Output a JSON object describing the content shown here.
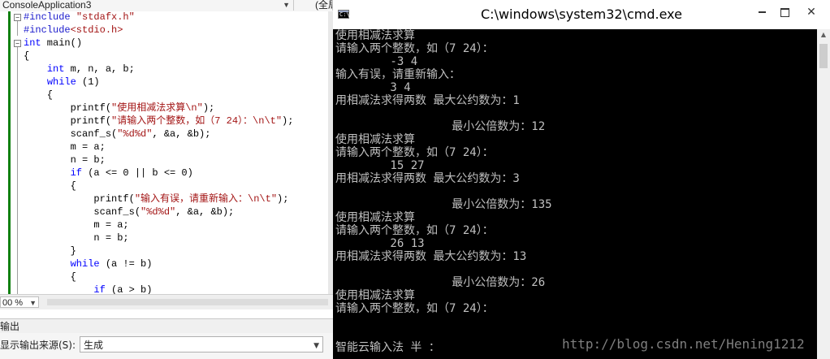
{
  "ide": {
    "nav_left": "ConsoleApplication3",
    "nav_right": "(全局范围)",
    "code": [
      [
        {
          "t": "#include ",
          "c": "pp"
        },
        {
          "t": "\"stdafx.h\"",
          "c": "str"
        }
      ],
      [
        {
          "t": "#include",
          "c": "pp"
        },
        {
          "t": "<stdio.h>",
          "c": "str"
        }
      ],
      [
        {
          "t": "int",
          "c": "kw"
        },
        {
          "t": " main()",
          "c": ""
        }
      ],
      [
        {
          "t": "{",
          "c": ""
        }
      ],
      [
        {
          "t": "    ",
          "c": ""
        },
        {
          "t": "int",
          "c": "kw"
        },
        {
          "t": " m, n, a, b;",
          "c": ""
        }
      ],
      [
        {
          "t": "    ",
          "c": ""
        },
        {
          "t": "while",
          "c": "kw"
        },
        {
          "t": " (1)",
          "c": ""
        }
      ],
      [
        {
          "t": "    {",
          "c": ""
        }
      ],
      [
        {
          "t": "        printf(",
          "c": ""
        },
        {
          "t": "\"使用相减法求算\\n\"",
          "c": "str"
        },
        {
          "t": ");",
          "c": ""
        }
      ],
      [
        {
          "t": "        printf(",
          "c": ""
        },
        {
          "t": "\"请输入两个整数，如（7 24）：\\n\\t\"",
          "c": "str"
        },
        {
          "t": ");",
          "c": ""
        }
      ],
      [
        {
          "t": "        scanf_s(",
          "c": ""
        },
        {
          "t": "\"%d%d\"",
          "c": "str"
        },
        {
          "t": ", &a, &b);",
          "c": ""
        }
      ],
      [
        {
          "t": "        m = a;",
          "c": ""
        }
      ],
      [
        {
          "t": "        n = b;",
          "c": ""
        }
      ],
      [
        {
          "t": "        ",
          "c": ""
        },
        {
          "t": "if",
          "c": "kw"
        },
        {
          "t": " (a <= 0 || b <= 0)",
          "c": ""
        }
      ],
      [
        {
          "t": "        {",
          "c": ""
        }
      ],
      [
        {
          "t": "            printf(",
          "c": ""
        },
        {
          "t": "\"输入有误，请重新输入：\\n\\t\"",
          "c": "str"
        },
        {
          "t": ");",
          "c": ""
        }
      ],
      [
        {
          "t": "            scanf_s(",
          "c": ""
        },
        {
          "t": "\"%d%d\"",
          "c": "str"
        },
        {
          "t": ", &a, &b);",
          "c": ""
        }
      ],
      [
        {
          "t": "            m = a;",
          "c": ""
        }
      ],
      [
        {
          "t": "            n = b;",
          "c": ""
        }
      ],
      [
        {
          "t": "        }",
          "c": ""
        }
      ],
      [
        {
          "t": "        ",
          "c": ""
        },
        {
          "t": "while",
          "c": "kw"
        },
        {
          "t": " (a != b)",
          "c": ""
        }
      ],
      [
        {
          "t": "        {",
          "c": ""
        }
      ],
      [
        {
          "t": "            ",
          "c": ""
        },
        {
          "t": "if",
          "c": "kw"
        },
        {
          "t": " (a > b)",
          "c": ""
        }
      ]
    ],
    "zoom": "00 %",
    "output_title": "输出",
    "output_source_label": "显示输出来源(S):",
    "output_source_value": "生成"
  },
  "cmd": {
    "title": "C:\\windows\\system32\\cmd.exe",
    "icon_glyph": "C:\\",
    "lines": [
      "使用相减法求算",
      "请输入两个整数，如（7 24）：",
      "        -3 4",
      "输入有误，请重新输入：",
      "        3 4",
      "用相减法求得两数 最大公约数为：1",
      "",
      "                 最小公倍数为：12",
      "使用相减法求算",
      "请输入两个整数，如（7 24）：",
      "        15 27",
      "用相减法求得两数 最大公约数为：3",
      "",
      "                 最小公倍数为：135",
      "使用相减法求算",
      "请输入两个整数，如（7 24）：",
      "        26 13",
      "用相减法求得两数 最大公约数为：13",
      "",
      "                 最小公倍数为：26",
      "使用相减法求算",
      "请输入两个整数，如（7 24）：",
      "",
      "",
      "智能云输入法 半 ："
    ],
    "watermark": "http://blog.csdn.net/Hening1212"
  }
}
